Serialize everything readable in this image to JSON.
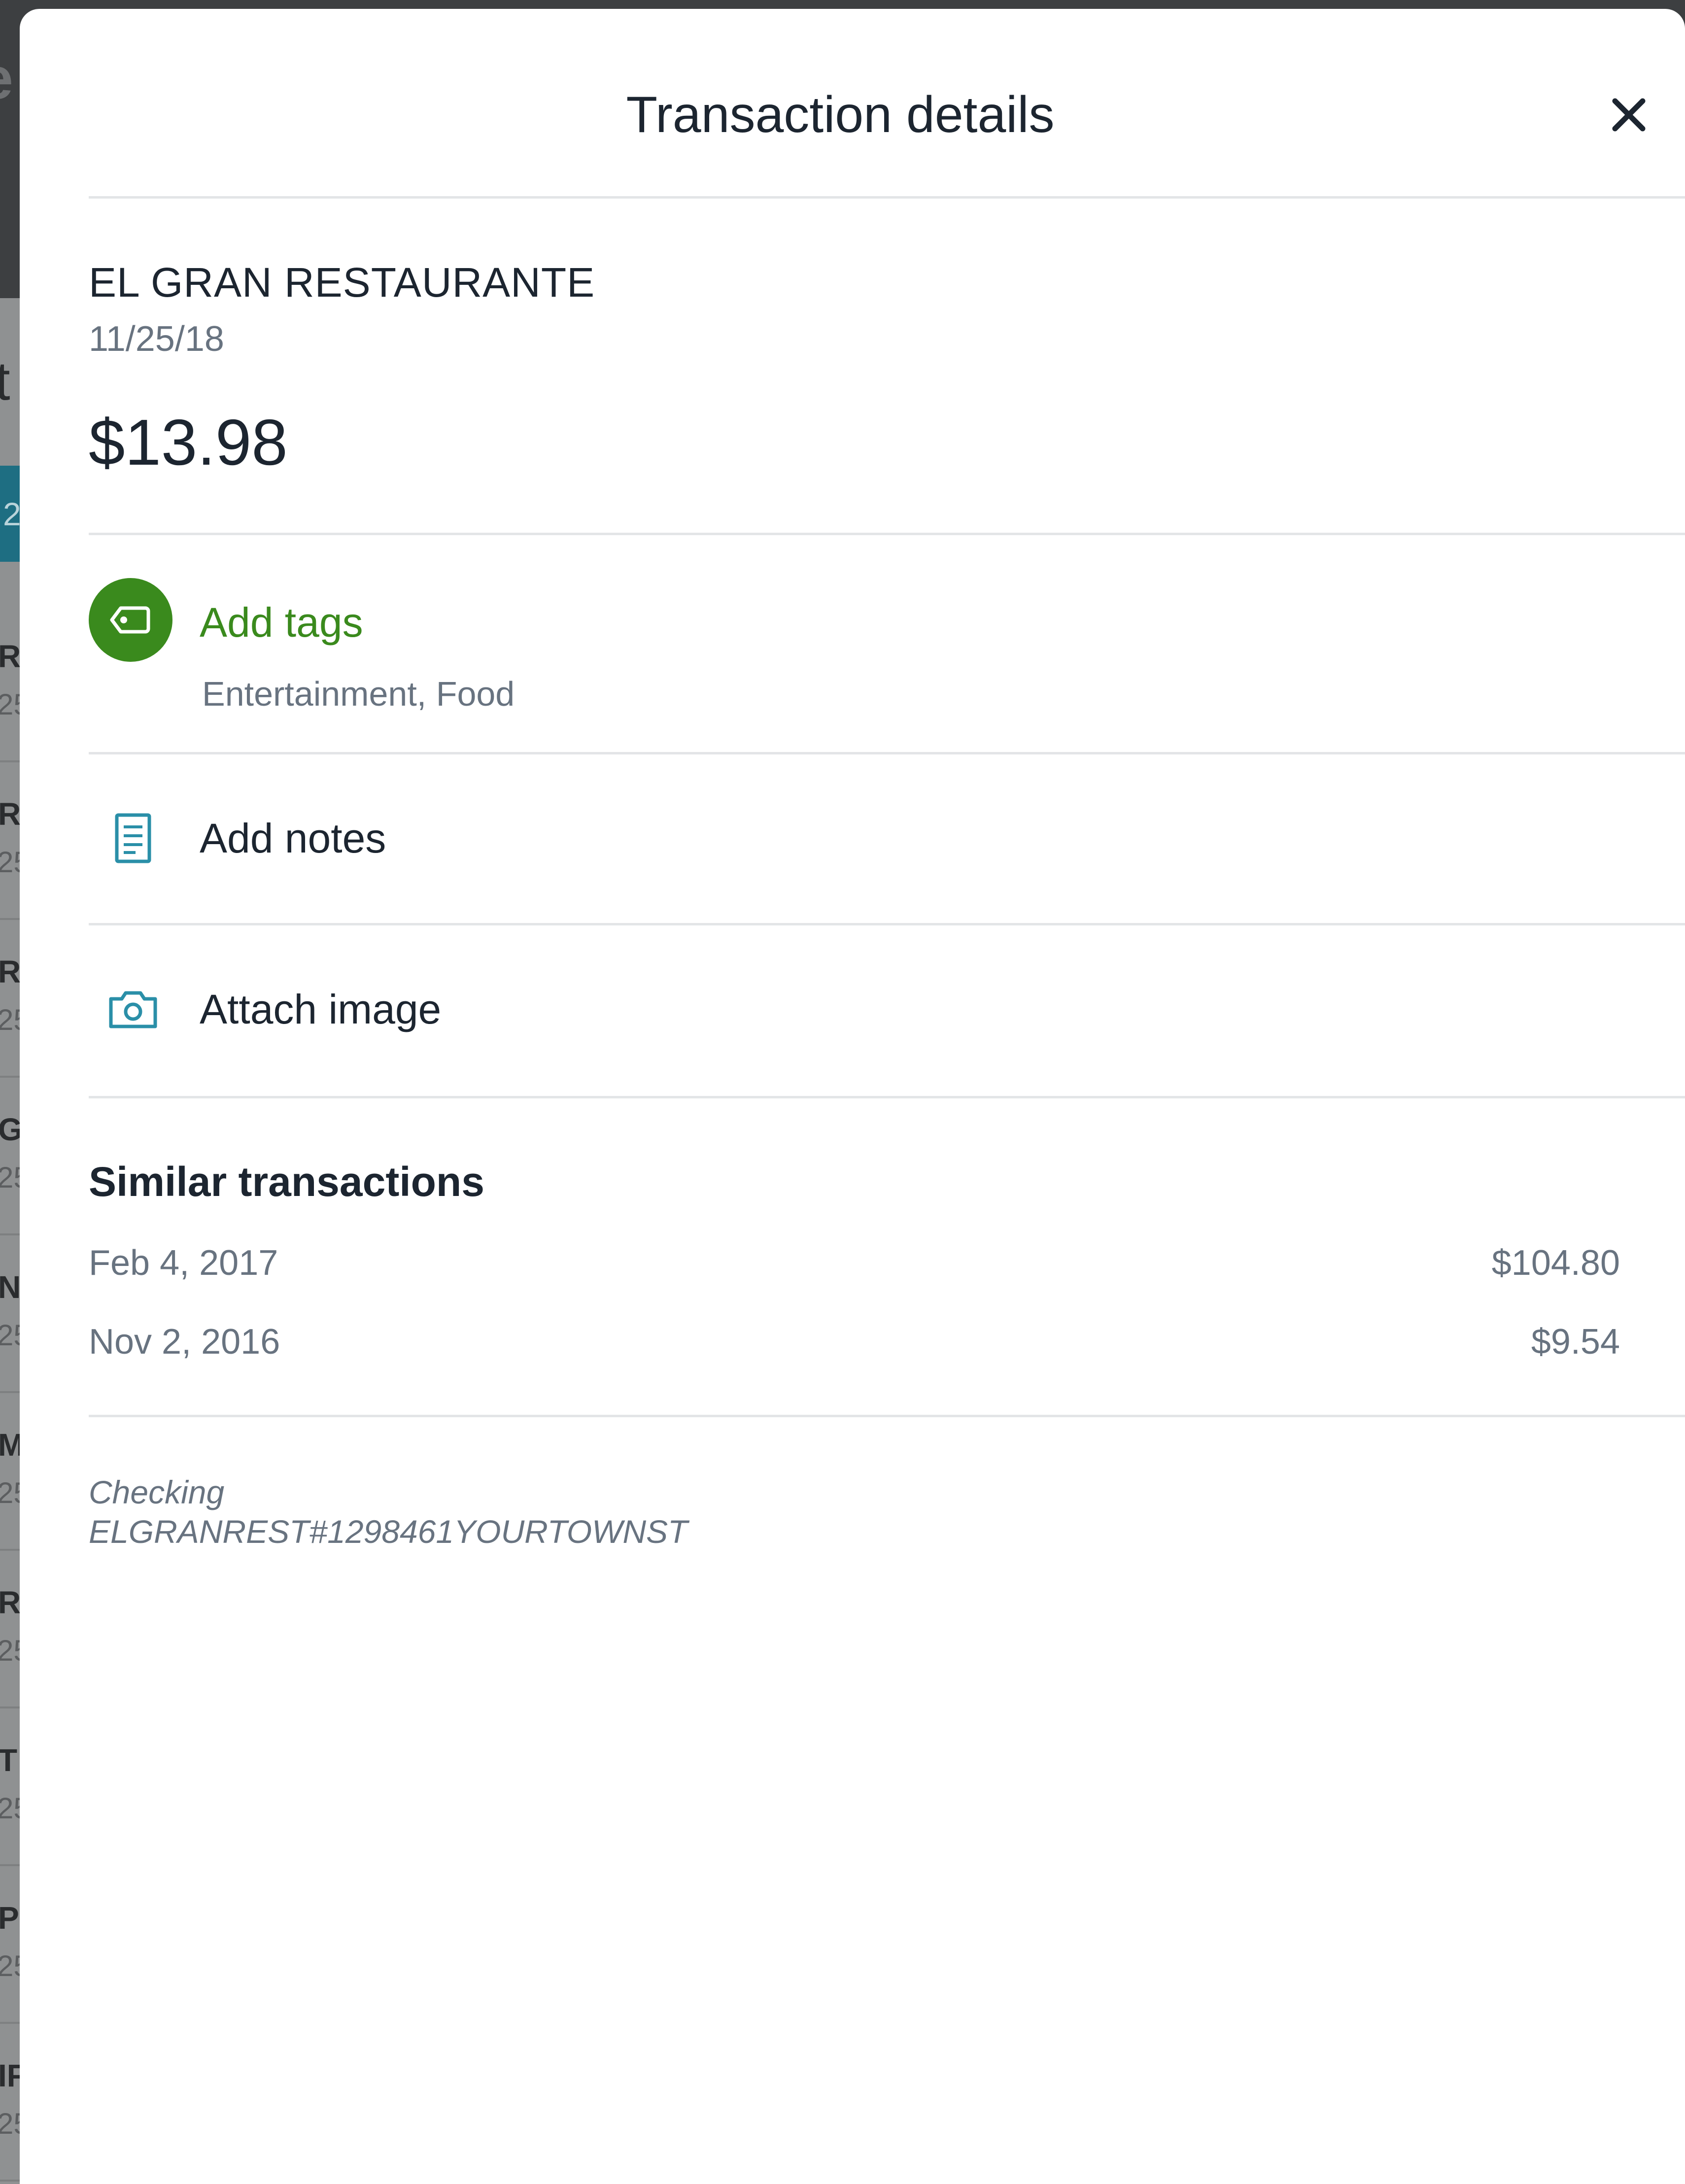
{
  "background": {
    "header_letter": "e",
    "title_letter": "t",
    "tab_letter": "2",
    "rows": [
      {
        "l1": "R",
        "l2": "25"
      },
      {
        "l1": "R",
        "l2": "25"
      },
      {
        "l1": "R",
        "l2": "25"
      },
      {
        "l1": "G",
        "l2": "25"
      },
      {
        "l1": "N",
        "l2": "25"
      },
      {
        "l1": "M",
        "l2": "25"
      },
      {
        "l1": "R",
        "l2": "25"
      },
      {
        "l1": "T",
        "l2": "25"
      },
      {
        "l1": "PL",
        "l2": "25"
      },
      {
        "l1": "IF",
        "l2": "25"
      }
    ]
  },
  "sheet": {
    "title": "Transaction details",
    "close_icon": "close-icon"
  },
  "transaction": {
    "merchant": "EL GRAN RESTAURANTE",
    "date": "11/25/18",
    "amount": "$13.98"
  },
  "tags": {
    "action_label": "Add tags",
    "value": "Entertainment, Food",
    "icon": "tag-icon",
    "accent_color": "#3a8a1d"
  },
  "notes": {
    "action_label": "Add notes",
    "icon": "notes-icon"
  },
  "attach": {
    "action_label": "Attach image",
    "icon": "camera-icon"
  },
  "similar": {
    "title": "Similar transactions",
    "items": [
      {
        "date": "Feb 4, 2017",
        "amount": "$104.80"
      },
      {
        "date": "Nov 2, 2016",
        "amount": "$9.54"
      }
    ]
  },
  "account": {
    "type": "Checking",
    "description": "ELGRANREST#1298461YOURTOWNST"
  },
  "colors": {
    "icon_teal": "#2a8fa8",
    "text_primary": "#1c2530",
    "text_secondary": "#687380"
  }
}
